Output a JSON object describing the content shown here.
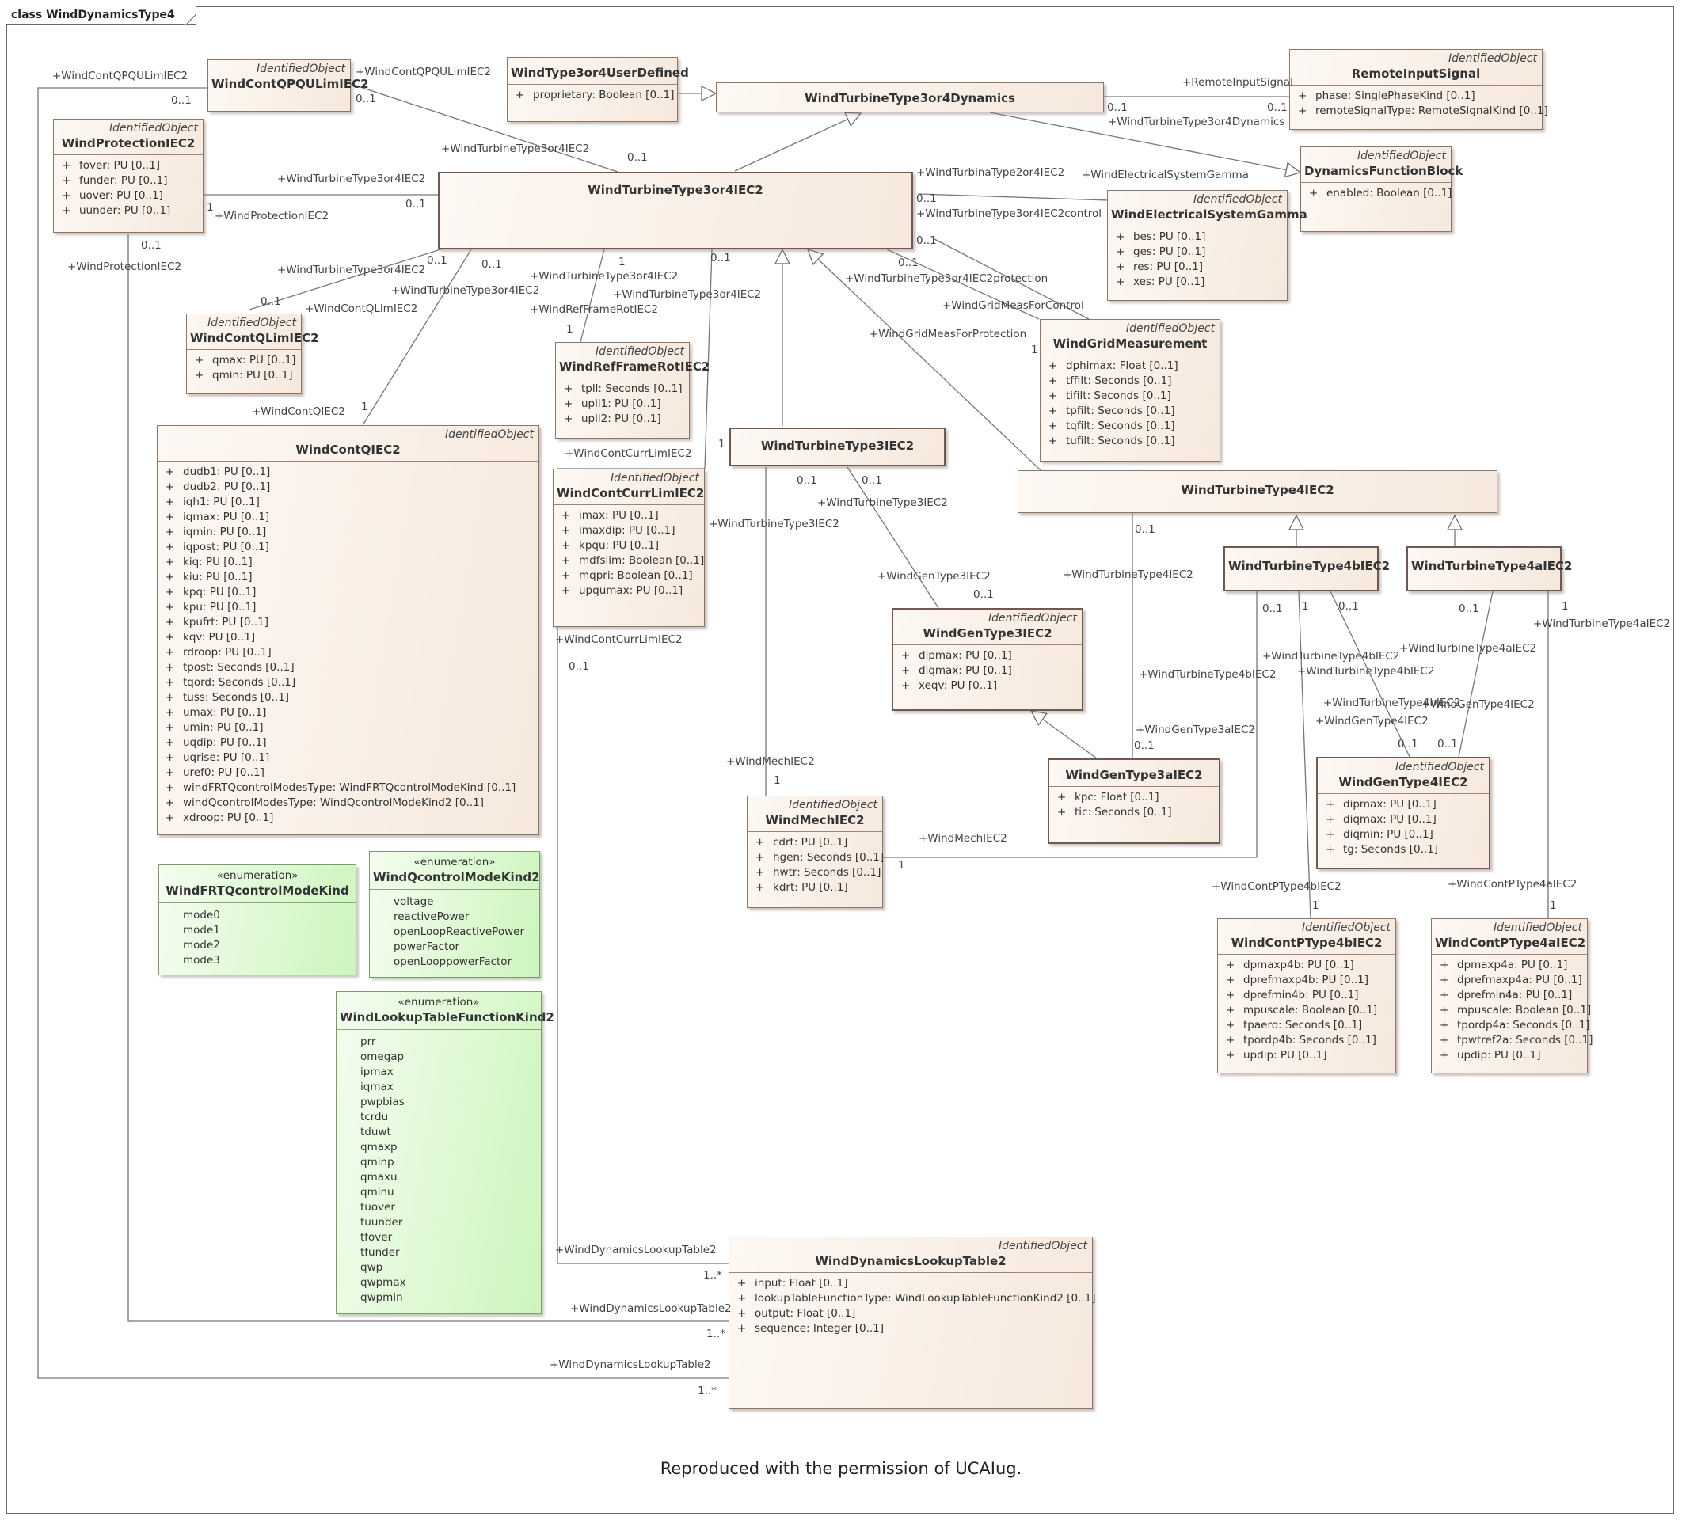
{
  "diagram_title": "class WindDynamicsType4",
  "caption": "Reproduced with the permission of UCAIug.",
  "classes": {
    "qpqu": {
      "stereotype": "IdentifiedObject",
      "name": "WindContQPQULimIEC2",
      "attributes": []
    },
    "userdef": {
      "stereotype": "",
      "name": "WindType3or4UserDefined",
      "attributes": [
        "proprietary: Boolean [0..1]"
      ]
    },
    "t34dyn": {
      "stereotype": "",
      "name": "WindTurbineType3or4Dynamics",
      "attributes": []
    },
    "remote": {
      "stereotype": "IdentifiedObject",
      "name": "RemoteInputSignal",
      "attributes": [
        "phase: SinglePhaseKind [0..1]",
        "remoteSignalType: RemoteSignalKind [0..1]"
      ]
    },
    "protect": {
      "stereotype": "IdentifiedObject",
      "name": "WindProtectionIEC2",
      "attributes": [
        "fover: PU [0..1]",
        "funder: PU [0..1]",
        "uover: PU [0..1]",
        "uunder: PU [0..1]"
      ]
    },
    "t34iec": {
      "stereotype": "",
      "name": "WindTurbineType3or4IEC2",
      "attributes": []
    },
    "dfb": {
      "stereotype": "IdentifiedObject",
      "name": "DynamicsFunctionBlock",
      "attributes": [
        "enabled: Boolean [0..1]"
      ]
    },
    "esg": {
      "stereotype": "IdentifiedObject",
      "name": "WindElectricalSystemGamma",
      "attributes": [
        "bes: PU [0..1]",
        "ges: PU [0..1]",
        "res: PU [0..1]",
        "xes: PU [0..1]"
      ]
    },
    "qlim": {
      "stereotype": "IdentifiedObject",
      "name": "WindContQLimIEC2",
      "attributes": [
        "qmax: PU [0..1]",
        "qmin: PU [0..1]"
      ]
    },
    "refframe": {
      "stereotype": "IdentifiedObject",
      "name": "WindRefFrameRotIEC2",
      "attributes": [
        "tpll: Seconds [0..1]",
        "upll1: PU [0..1]",
        "upll2: PU [0..1]"
      ]
    },
    "gridmeas": {
      "stereotype": "IdentifiedObject",
      "name": "WindGridMeasurement",
      "attributes": [
        "dphimax: Float [0..1]",
        "tffilt: Seconds [0..1]",
        "tifilt: Seconds [0..1]",
        "tpfilt: Seconds [0..1]",
        "tqfilt: Seconds [0..1]",
        "tufilt: Seconds [0..1]"
      ]
    },
    "contq": {
      "stereotype": "IdentifiedObject",
      "name": "WindContQIEC2",
      "attributes": [
        "dudb1: PU [0..1]",
        "dudb2: PU [0..1]",
        "iqh1: PU [0..1]",
        "iqmax: PU [0..1]",
        "iqmin: PU [0..1]",
        "iqpost: PU [0..1]",
        "kiq: PU [0..1]",
        "kiu: PU [0..1]",
        "kpq: PU [0..1]",
        "kpu: PU [0..1]",
        "kpufrt: PU [0..1]",
        "kqv: PU [0..1]",
        "rdroop: PU [0..1]",
        "tpost: Seconds [0..1]",
        "tqord: Seconds [0..1]",
        "tuss: Seconds [0..1]",
        "umax: PU [0..1]",
        "umin: PU [0..1]",
        "uqdip: PU [0..1]",
        "uqrise: PU [0..1]",
        "uref0: PU [0..1]",
        "windFRTQcontrolModesType: WindFRTQcontrolModeKind [0..1]",
        "windQcontrolModesType: WindQcontrolModeKind2 [0..1]",
        "xdroop: PU [0..1]"
      ]
    },
    "currlim": {
      "stereotype": "IdentifiedObject",
      "name": "WindContCurrLimIEC2",
      "attributes": [
        "imax: PU [0..1]",
        "imaxdip: PU [0..1]",
        "kpqu: PU [0..1]",
        "mdfslim: Boolean [0..1]",
        "mqpri: Boolean [0..1]",
        "upqumax: PU [0..1]"
      ]
    },
    "t3": {
      "stereotype": "",
      "name": "WindTurbineType3IEC2",
      "attributes": []
    },
    "t4": {
      "stereotype": "",
      "name": "WindTurbineType4IEC2",
      "attributes": []
    },
    "t4b": {
      "stereotype": "",
      "name": "WindTurbineType4bIEC2",
      "attributes": []
    },
    "t4a": {
      "stereotype": "",
      "name": "WindTurbineType4aIEC2",
      "attributes": []
    },
    "gen3": {
      "stereotype": "IdentifiedObject",
      "name": "WindGenType3IEC2",
      "attributes": [
        "dipmax: PU [0..1]",
        "diqmax: PU [0..1]",
        "xeqv: PU [0..1]"
      ]
    },
    "gen3a": {
      "stereotype": "",
      "name": "WindGenType3aIEC2",
      "attributes": [
        "kpc: Float [0..1]",
        "tic: Seconds [0..1]"
      ]
    },
    "gen4": {
      "stereotype": "IdentifiedObject",
      "name": "WindGenType4IEC2",
      "attributes": [
        "dipmax: PU [0..1]",
        "diqmax: PU [0..1]",
        "diqmin: PU [0..1]",
        "tg: Seconds [0..1]"
      ]
    },
    "mech": {
      "stereotype": "IdentifiedObject",
      "name": "WindMechIEC2",
      "attributes": [
        "cdrt: PU [0..1]",
        "hgen: Seconds [0..1]",
        "hwtr: Seconds [0..1]",
        "kdrt: PU [0..1]"
      ]
    },
    "cp4b": {
      "stereotype": "IdentifiedObject",
      "name": "WindContPType4bIEC2",
      "attributes": [
        "dpmaxp4b: PU [0..1]",
        "dprefmaxp4b: PU [0..1]",
        "dprefmin4b: PU [0..1]",
        "mpuscale: Boolean [0..1]",
        "tpaero: Seconds [0..1]",
        "tpordp4b: Seconds [0..1]",
        "updip: PU [0..1]"
      ]
    },
    "cp4a": {
      "stereotype": "IdentifiedObject",
      "name": "WindContPType4aIEC2",
      "attributes": [
        "dpmaxp4a: PU [0..1]",
        "dprefmaxp4a: PU [0..1]",
        "dprefmin4a: PU [0..1]",
        "mpuscale: Boolean [0..1]",
        "tpordp4a: Seconds [0..1]",
        "tpwtref2a: Seconds [0..1]",
        "updip: PU [0..1]"
      ]
    },
    "lookup": {
      "stereotype": "IdentifiedObject",
      "name": "WindDynamicsLookupTable2",
      "attributes": [
        "input: Float [0..1]",
        "lookupTableFunctionType: WindLookupTableFunctionKind2 [0..1]",
        "output: Float [0..1]",
        "sequence: Integer [0..1]"
      ]
    }
  },
  "enums": {
    "frtq": {
      "stereotype": "«enumeration»",
      "name": "WindFRTQcontrolModeKind",
      "literals": [
        "mode0",
        "mode1",
        "mode2",
        "mode3"
      ]
    },
    "qctl": {
      "stereotype": "«enumeration»",
      "name": "WindQcontrolModeKind2",
      "literals": [
        "voltage",
        "reactivePower",
        "openLoopReactivePower",
        "powerFactor",
        "openLooppowerFactor"
      ]
    },
    "lookupkind": {
      "stereotype": "«enumeration»",
      "name": "WindLookupTableFunctionKind2",
      "literals": [
        "prr",
        "omegap",
        "ipmax",
        "iqmax",
        "pwpbias",
        "tcrdu",
        "tduwt",
        "qmaxp",
        "qminp",
        "qmaxu",
        "qminu",
        "tuover",
        "tuunder",
        "tfover",
        "tfunder",
        "qwp",
        "qwpmax",
        "qwpmin"
      ]
    }
  },
  "labels": [
    "+WindContQPQULimIEC2",
    "0..1",
    "+WindContQPQULimIEC2",
    "0..1",
    "+WindTurbineType3or4IEC2",
    "0..1",
    "+RemoteInputSignal",
    "0..1",
    "0..1",
    "+WindTurbineType3or4Dynamics",
    "+WindTurbineType3or4IEC2",
    "0..1",
    "1",
    "+WindProtectionIEC2",
    "0..1",
    "+WindProtectionIEC2",
    "+WindTurbinaType2or4IEC2",
    "+WindElectricalSystemGamma",
    "0..1",
    "+WindTurbineType3or4IEC2control",
    "0..1",
    "+WindTurbineType3or4IEC2",
    "0..1",
    "0..1",
    "+WindContQLimIEC2",
    "0..1",
    "+WindTurbineType3or4IEC2",
    "1",
    "+WindTurbineType3or4IEC2",
    "+WindRefFrameRotIEC2",
    "1",
    "0..1",
    "+WindTurbineType3or4IEC2",
    "0..1",
    "+WindTurbineType3or4IEC2protection",
    "+WindGridMeasForControl",
    "+WindGridMeasForProtection",
    "1",
    "+WindContQIEC2",
    "1",
    "+WindContCurrLimIEC2",
    "1",
    "0..1",
    "0..1",
    "+WindTurbineType3IEC2",
    "+WindTurbineType3IEC2",
    "+WindGenType3IEC2",
    "0..1",
    "+WindContCurrLimIEC2",
    "0..1",
    "0..1",
    "+WindTurbineType4IEC2",
    "0..1",
    "1",
    "0..1",
    "0..1",
    "1",
    "+WindTurbineType4aIEC2",
    "+WindTurbineType4bIEC2",
    "+WindTurbineType4bIEC2",
    "+WindTurbineType4aIEC2",
    "+WindTurbineType4bIEC2",
    "+WindTurbineType4bIEC2",
    "+WindGenType4IEC2",
    "+WindGenType4IEC2",
    "+WindGenType3aIEC2",
    "0..1",
    "0..1",
    "0..1",
    "+WindMechIEC2",
    "1",
    "+WindMechIEC2",
    "1",
    "+WindContPType4bIEC2",
    "1",
    "+WindContPType4aIEC2",
    "1",
    "+WindDynamicsLookupTable2",
    "1..*",
    "+WindDynamicsLookupTable2",
    "1..*",
    "+WindDynamicsLookupTable2",
    "1..*"
  ]
}
